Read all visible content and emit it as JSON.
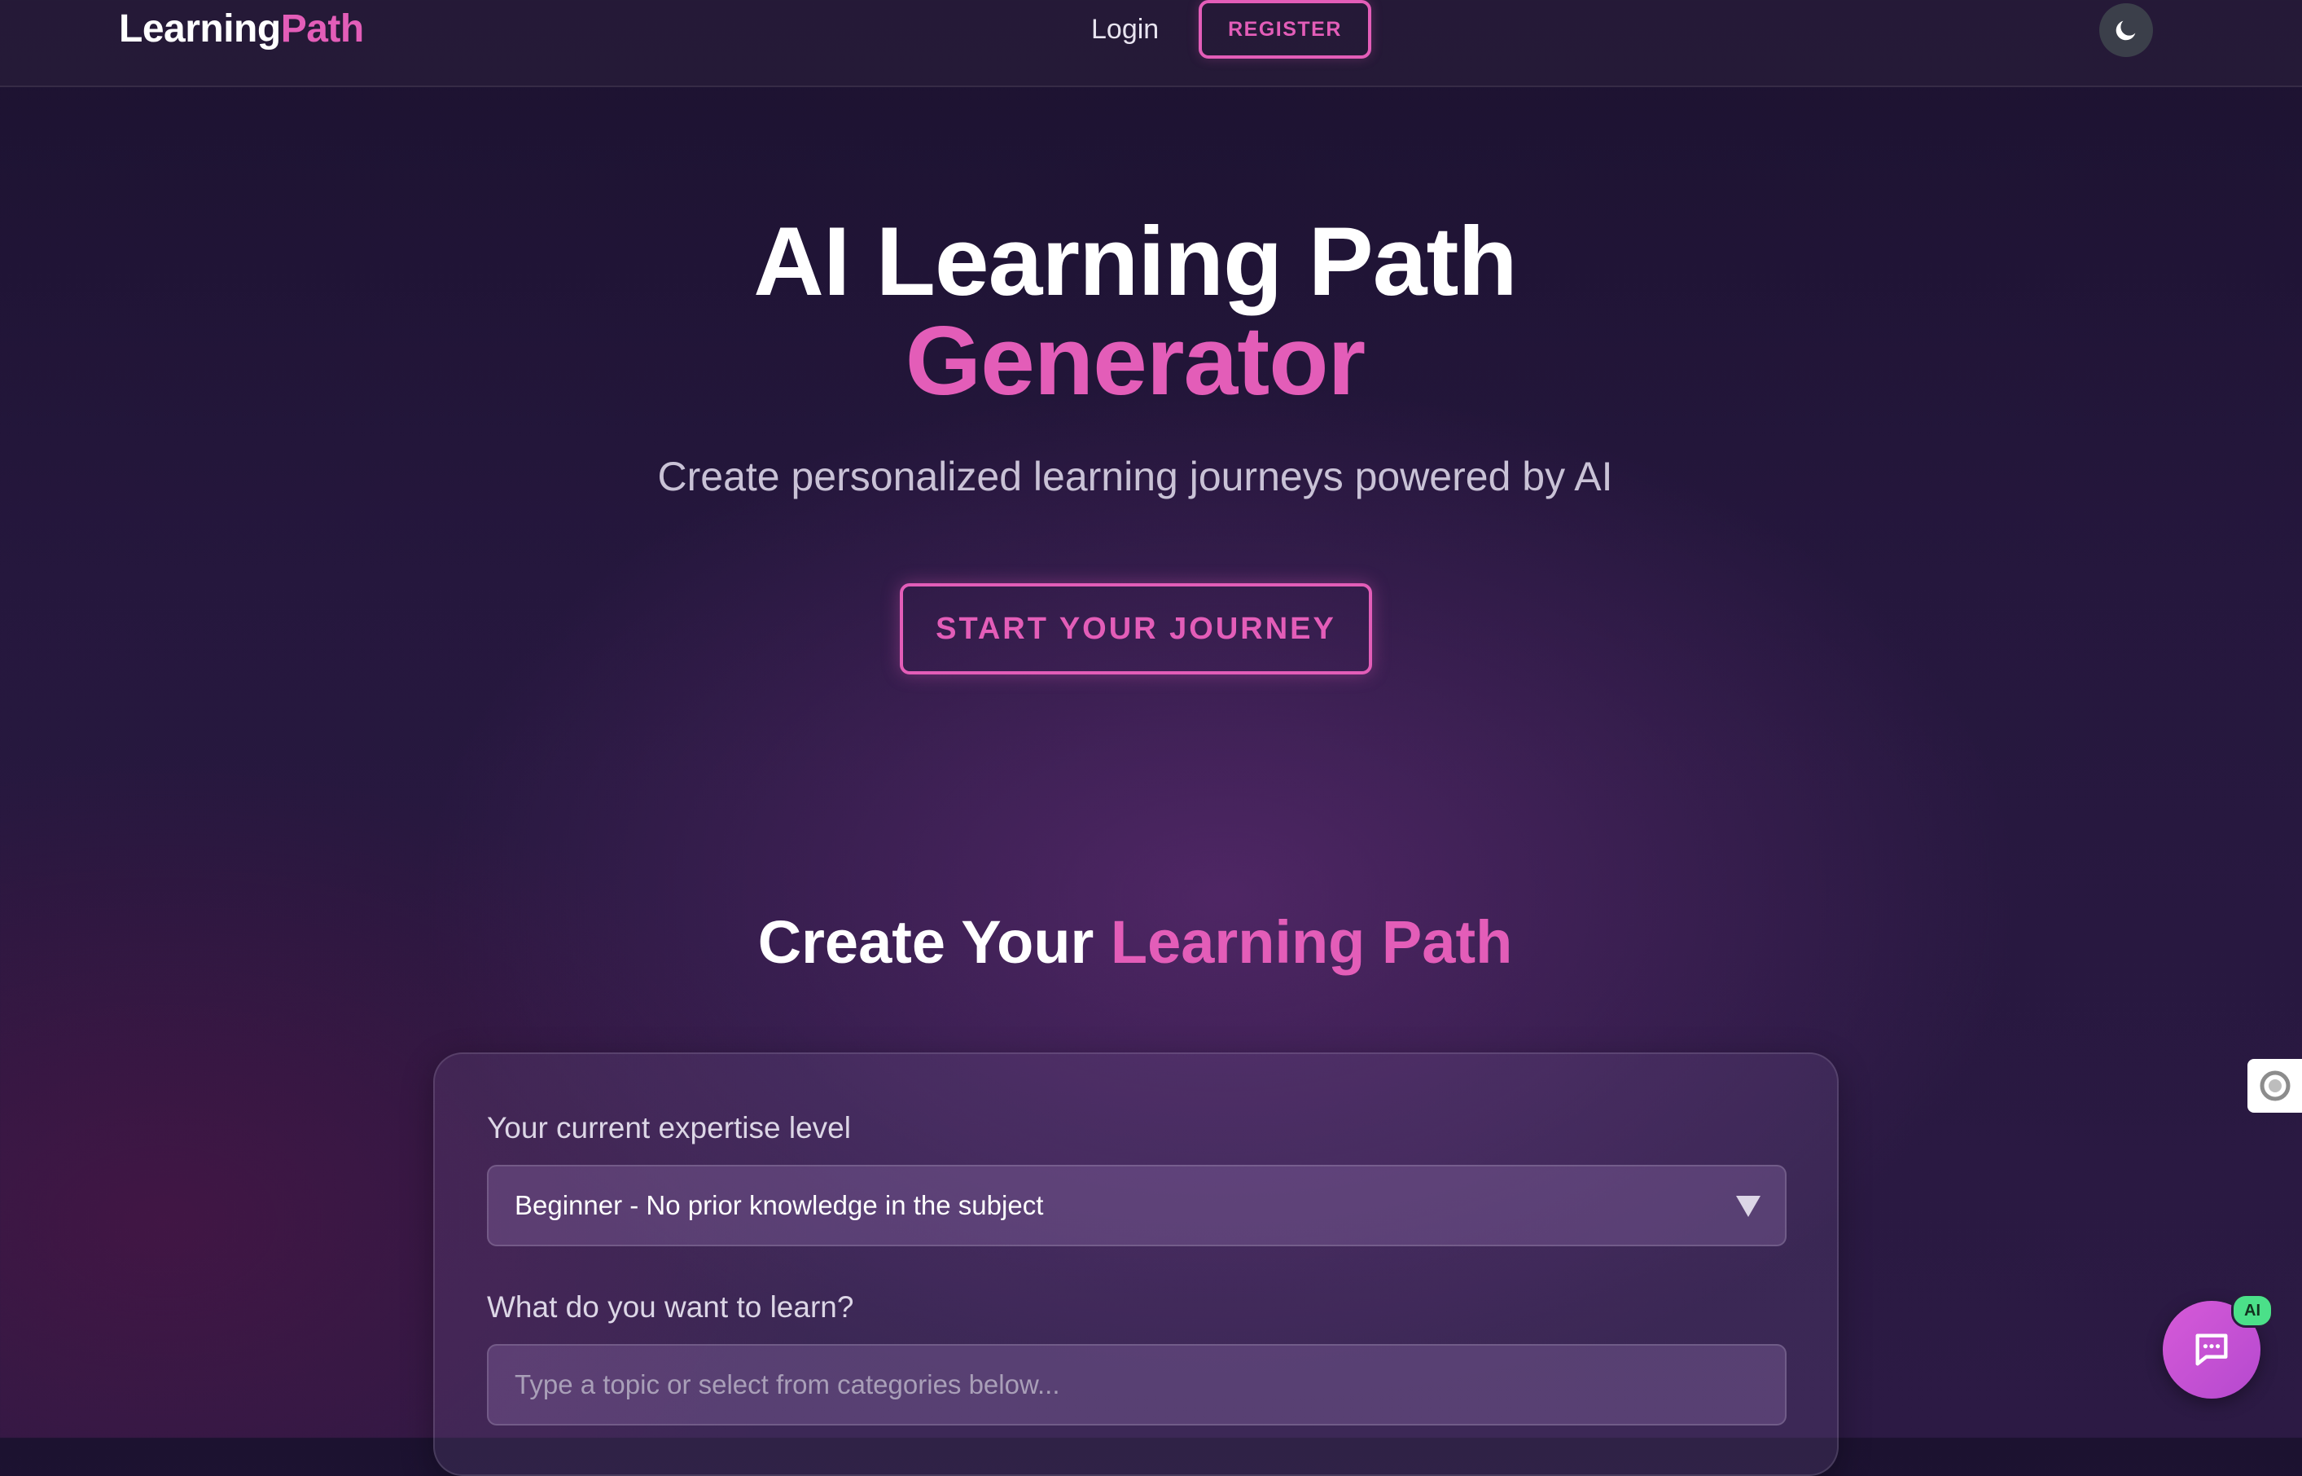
{
  "nav": {
    "logo_main": "Learning",
    "logo_accent": "Path",
    "login_label": "Login",
    "register_label": "REGISTER",
    "theme_icon": "moon-icon"
  },
  "hero": {
    "title_line1": "AI Learning Path",
    "title_line2": "Generator",
    "subtitle": "Create personalized learning journeys powered by AI",
    "cta_label": "START YOUR JOURNEY"
  },
  "section": {
    "title_main": "Create Your ",
    "title_accent": "Learning Path"
  },
  "form": {
    "expertise_label": "Your current expertise level",
    "expertise_value": "Beginner - No prior knowledge in the subject",
    "topic_label": "What do you want to learn?",
    "topic_placeholder": "Type a topic or select from categories below..."
  },
  "widgets": {
    "chat_icon": "chat-bubble-icon",
    "ai_badge": "AI",
    "side_icon": "extension-icon"
  },
  "colors": {
    "accent": "#e35db8",
    "background": "#25173d",
    "badge": "#4be089"
  }
}
